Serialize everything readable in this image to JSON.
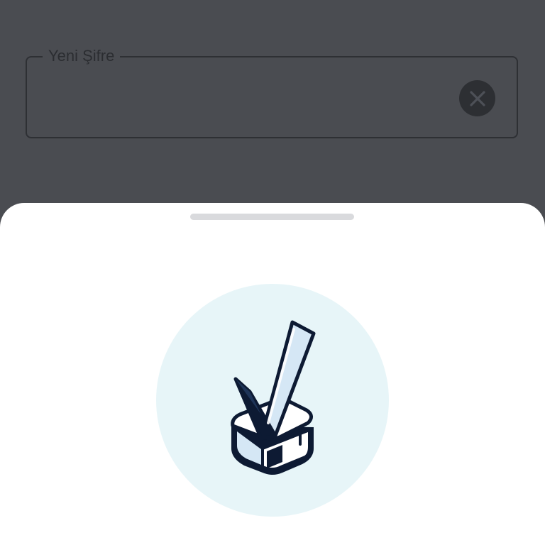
{
  "form": {
    "new_password_label": "Yeni Şifre",
    "new_password_value": "",
    "clear_icon": "close-icon"
  },
  "sheet": {
    "illustration": "checkmark-stamp-icon"
  },
  "colors": {
    "overlay": "#4a4c51",
    "sheet_bg": "#ffffff",
    "illustration_circle": "#e7f5f8",
    "illustration_stroke": "#0d1a33"
  }
}
